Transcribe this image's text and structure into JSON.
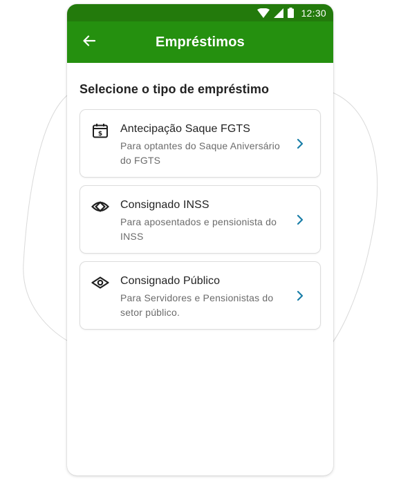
{
  "status_bar": {
    "time": "12:30",
    "wifi_icon": "wifi-icon",
    "signal_icon": "signal-icon",
    "battery_icon": "battery-icon"
  },
  "app_bar": {
    "title": "Empréstimos",
    "back_icon": "arrow-left-icon"
  },
  "main": {
    "heading": "Selecione o tipo de empréstimo",
    "options": [
      {
        "icon": "calendar-money-icon",
        "title": "Antecipação Saque FGTS",
        "description": "Para optantes do Saque Aniversário do FGTS"
      },
      {
        "icon": "eye-slash-icon",
        "title": "Consignado INSS",
        "description": "Para aposentados e pensionista do INSS"
      },
      {
        "icon": "eye-icon",
        "title": "Consignado Público",
        "description": "Para Servidores e Pensionistas do setor público."
      }
    ]
  },
  "colors": {
    "status_bar": "#237a0c",
    "app_bar": "#25900f",
    "chevron": "#1a7ea8",
    "icon": "#1f1f1f"
  }
}
